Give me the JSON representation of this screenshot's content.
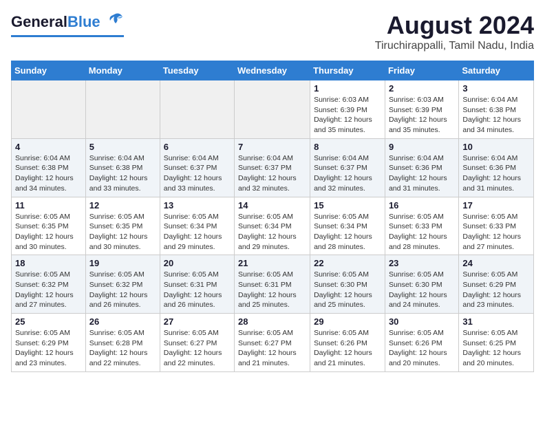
{
  "header": {
    "logo_general": "General",
    "logo_blue": "Blue",
    "month_year": "August 2024",
    "location": "Tiruchirappalli, Tamil Nadu, India"
  },
  "weekdays": [
    "Sunday",
    "Monday",
    "Tuesday",
    "Wednesday",
    "Thursday",
    "Friday",
    "Saturday"
  ],
  "weeks": [
    [
      {
        "day": "",
        "info": ""
      },
      {
        "day": "",
        "info": ""
      },
      {
        "day": "",
        "info": ""
      },
      {
        "day": "",
        "info": ""
      },
      {
        "day": "1",
        "info": "Sunrise: 6:03 AM\nSunset: 6:39 PM\nDaylight: 12 hours\nand 35 minutes."
      },
      {
        "day": "2",
        "info": "Sunrise: 6:03 AM\nSunset: 6:39 PM\nDaylight: 12 hours\nand 35 minutes."
      },
      {
        "day": "3",
        "info": "Sunrise: 6:04 AM\nSunset: 6:38 PM\nDaylight: 12 hours\nand 34 minutes."
      }
    ],
    [
      {
        "day": "4",
        "info": "Sunrise: 6:04 AM\nSunset: 6:38 PM\nDaylight: 12 hours\nand 34 minutes."
      },
      {
        "day": "5",
        "info": "Sunrise: 6:04 AM\nSunset: 6:38 PM\nDaylight: 12 hours\nand 33 minutes."
      },
      {
        "day": "6",
        "info": "Sunrise: 6:04 AM\nSunset: 6:37 PM\nDaylight: 12 hours\nand 33 minutes."
      },
      {
        "day": "7",
        "info": "Sunrise: 6:04 AM\nSunset: 6:37 PM\nDaylight: 12 hours\nand 32 minutes."
      },
      {
        "day": "8",
        "info": "Sunrise: 6:04 AM\nSunset: 6:37 PM\nDaylight: 12 hours\nand 32 minutes."
      },
      {
        "day": "9",
        "info": "Sunrise: 6:04 AM\nSunset: 6:36 PM\nDaylight: 12 hours\nand 31 minutes."
      },
      {
        "day": "10",
        "info": "Sunrise: 6:04 AM\nSunset: 6:36 PM\nDaylight: 12 hours\nand 31 minutes."
      }
    ],
    [
      {
        "day": "11",
        "info": "Sunrise: 6:05 AM\nSunset: 6:35 PM\nDaylight: 12 hours\nand 30 minutes."
      },
      {
        "day": "12",
        "info": "Sunrise: 6:05 AM\nSunset: 6:35 PM\nDaylight: 12 hours\nand 30 minutes."
      },
      {
        "day": "13",
        "info": "Sunrise: 6:05 AM\nSunset: 6:34 PM\nDaylight: 12 hours\nand 29 minutes."
      },
      {
        "day": "14",
        "info": "Sunrise: 6:05 AM\nSunset: 6:34 PM\nDaylight: 12 hours\nand 29 minutes."
      },
      {
        "day": "15",
        "info": "Sunrise: 6:05 AM\nSunset: 6:34 PM\nDaylight: 12 hours\nand 28 minutes."
      },
      {
        "day": "16",
        "info": "Sunrise: 6:05 AM\nSunset: 6:33 PM\nDaylight: 12 hours\nand 28 minutes."
      },
      {
        "day": "17",
        "info": "Sunrise: 6:05 AM\nSunset: 6:33 PM\nDaylight: 12 hours\nand 27 minutes."
      }
    ],
    [
      {
        "day": "18",
        "info": "Sunrise: 6:05 AM\nSunset: 6:32 PM\nDaylight: 12 hours\nand 27 minutes."
      },
      {
        "day": "19",
        "info": "Sunrise: 6:05 AM\nSunset: 6:32 PM\nDaylight: 12 hours\nand 26 minutes."
      },
      {
        "day": "20",
        "info": "Sunrise: 6:05 AM\nSunset: 6:31 PM\nDaylight: 12 hours\nand 26 minutes."
      },
      {
        "day": "21",
        "info": "Sunrise: 6:05 AM\nSunset: 6:31 PM\nDaylight: 12 hours\nand 25 minutes."
      },
      {
        "day": "22",
        "info": "Sunrise: 6:05 AM\nSunset: 6:30 PM\nDaylight: 12 hours\nand 25 minutes."
      },
      {
        "day": "23",
        "info": "Sunrise: 6:05 AM\nSunset: 6:30 PM\nDaylight: 12 hours\nand 24 minutes."
      },
      {
        "day": "24",
        "info": "Sunrise: 6:05 AM\nSunset: 6:29 PM\nDaylight: 12 hours\nand 23 minutes."
      }
    ],
    [
      {
        "day": "25",
        "info": "Sunrise: 6:05 AM\nSunset: 6:29 PM\nDaylight: 12 hours\nand 23 minutes."
      },
      {
        "day": "26",
        "info": "Sunrise: 6:05 AM\nSunset: 6:28 PM\nDaylight: 12 hours\nand 22 minutes."
      },
      {
        "day": "27",
        "info": "Sunrise: 6:05 AM\nSunset: 6:27 PM\nDaylight: 12 hours\nand 22 minutes."
      },
      {
        "day": "28",
        "info": "Sunrise: 6:05 AM\nSunset: 6:27 PM\nDaylight: 12 hours\nand 21 minutes."
      },
      {
        "day": "29",
        "info": "Sunrise: 6:05 AM\nSunset: 6:26 PM\nDaylight: 12 hours\nand 21 minutes."
      },
      {
        "day": "30",
        "info": "Sunrise: 6:05 AM\nSunset: 6:26 PM\nDaylight: 12 hours\nand 20 minutes."
      },
      {
        "day": "31",
        "info": "Sunrise: 6:05 AM\nSunset: 6:25 PM\nDaylight: 12 hours\nand 20 minutes."
      }
    ]
  ]
}
